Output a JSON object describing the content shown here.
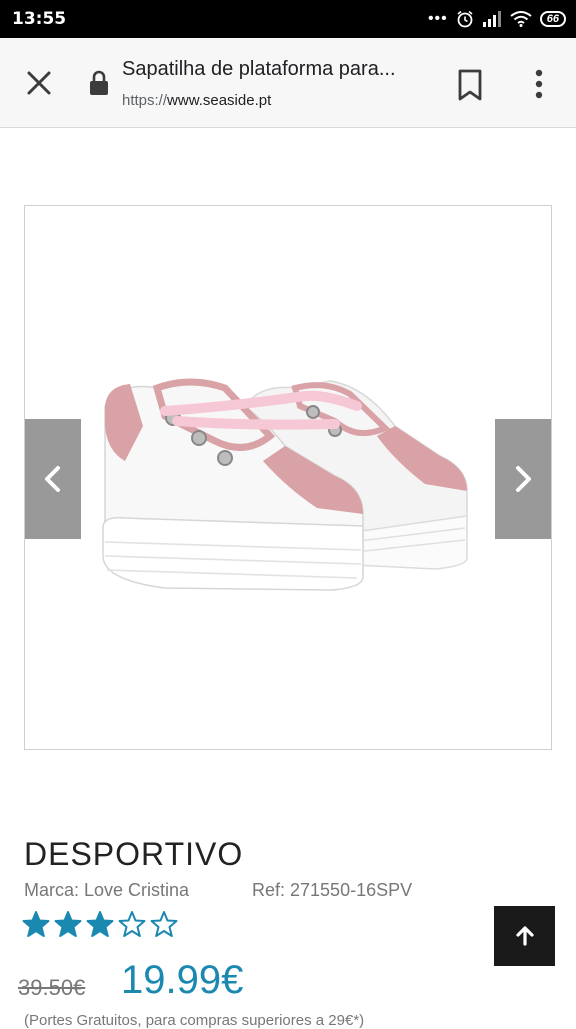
{
  "status_bar": {
    "time": "13:55",
    "battery": "66",
    "icons": [
      "more-dots-icon",
      "alarm-icon",
      "signal-icon",
      "wifi-icon",
      "battery-icon"
    ]
  },
  "browser": {
    "page_title": "Sapatilha de plataforma para...",
    "url_scheme": "https://",
    "url_host": "www.seaside.pt",
    "icons": [
      "close-icon",
      "lock-icon",
      "bookmark-icon",
      "overflow-menu-icon"
    ]
  },
  "gallery": {
    "prev_icon": "chevron-left-icon",
    "next_icon": "chevron-right-icon"
  },
  "product": {
    "name": "DESPORTIVO",
    "brand": "Marca: Love Cristina",
    "ref": "Ref: 271550-16SPV",
    "rating": 3,
    "rating_max": 5,
    "old_price": "39.50€",
    "price": "19.99€",
    "shipping_note": "(Portes Gratuitos, para compras superiores a 29€*)"
  },
  "colors": {
    "accent": "#1b88b0",
    "star": "#1b88b0",
    "arrow_bg": "#999999",
    "back_top_bg": "#1a1a1a"
  },
  "back_to_top_icon": "arrow-up-icon"
}
